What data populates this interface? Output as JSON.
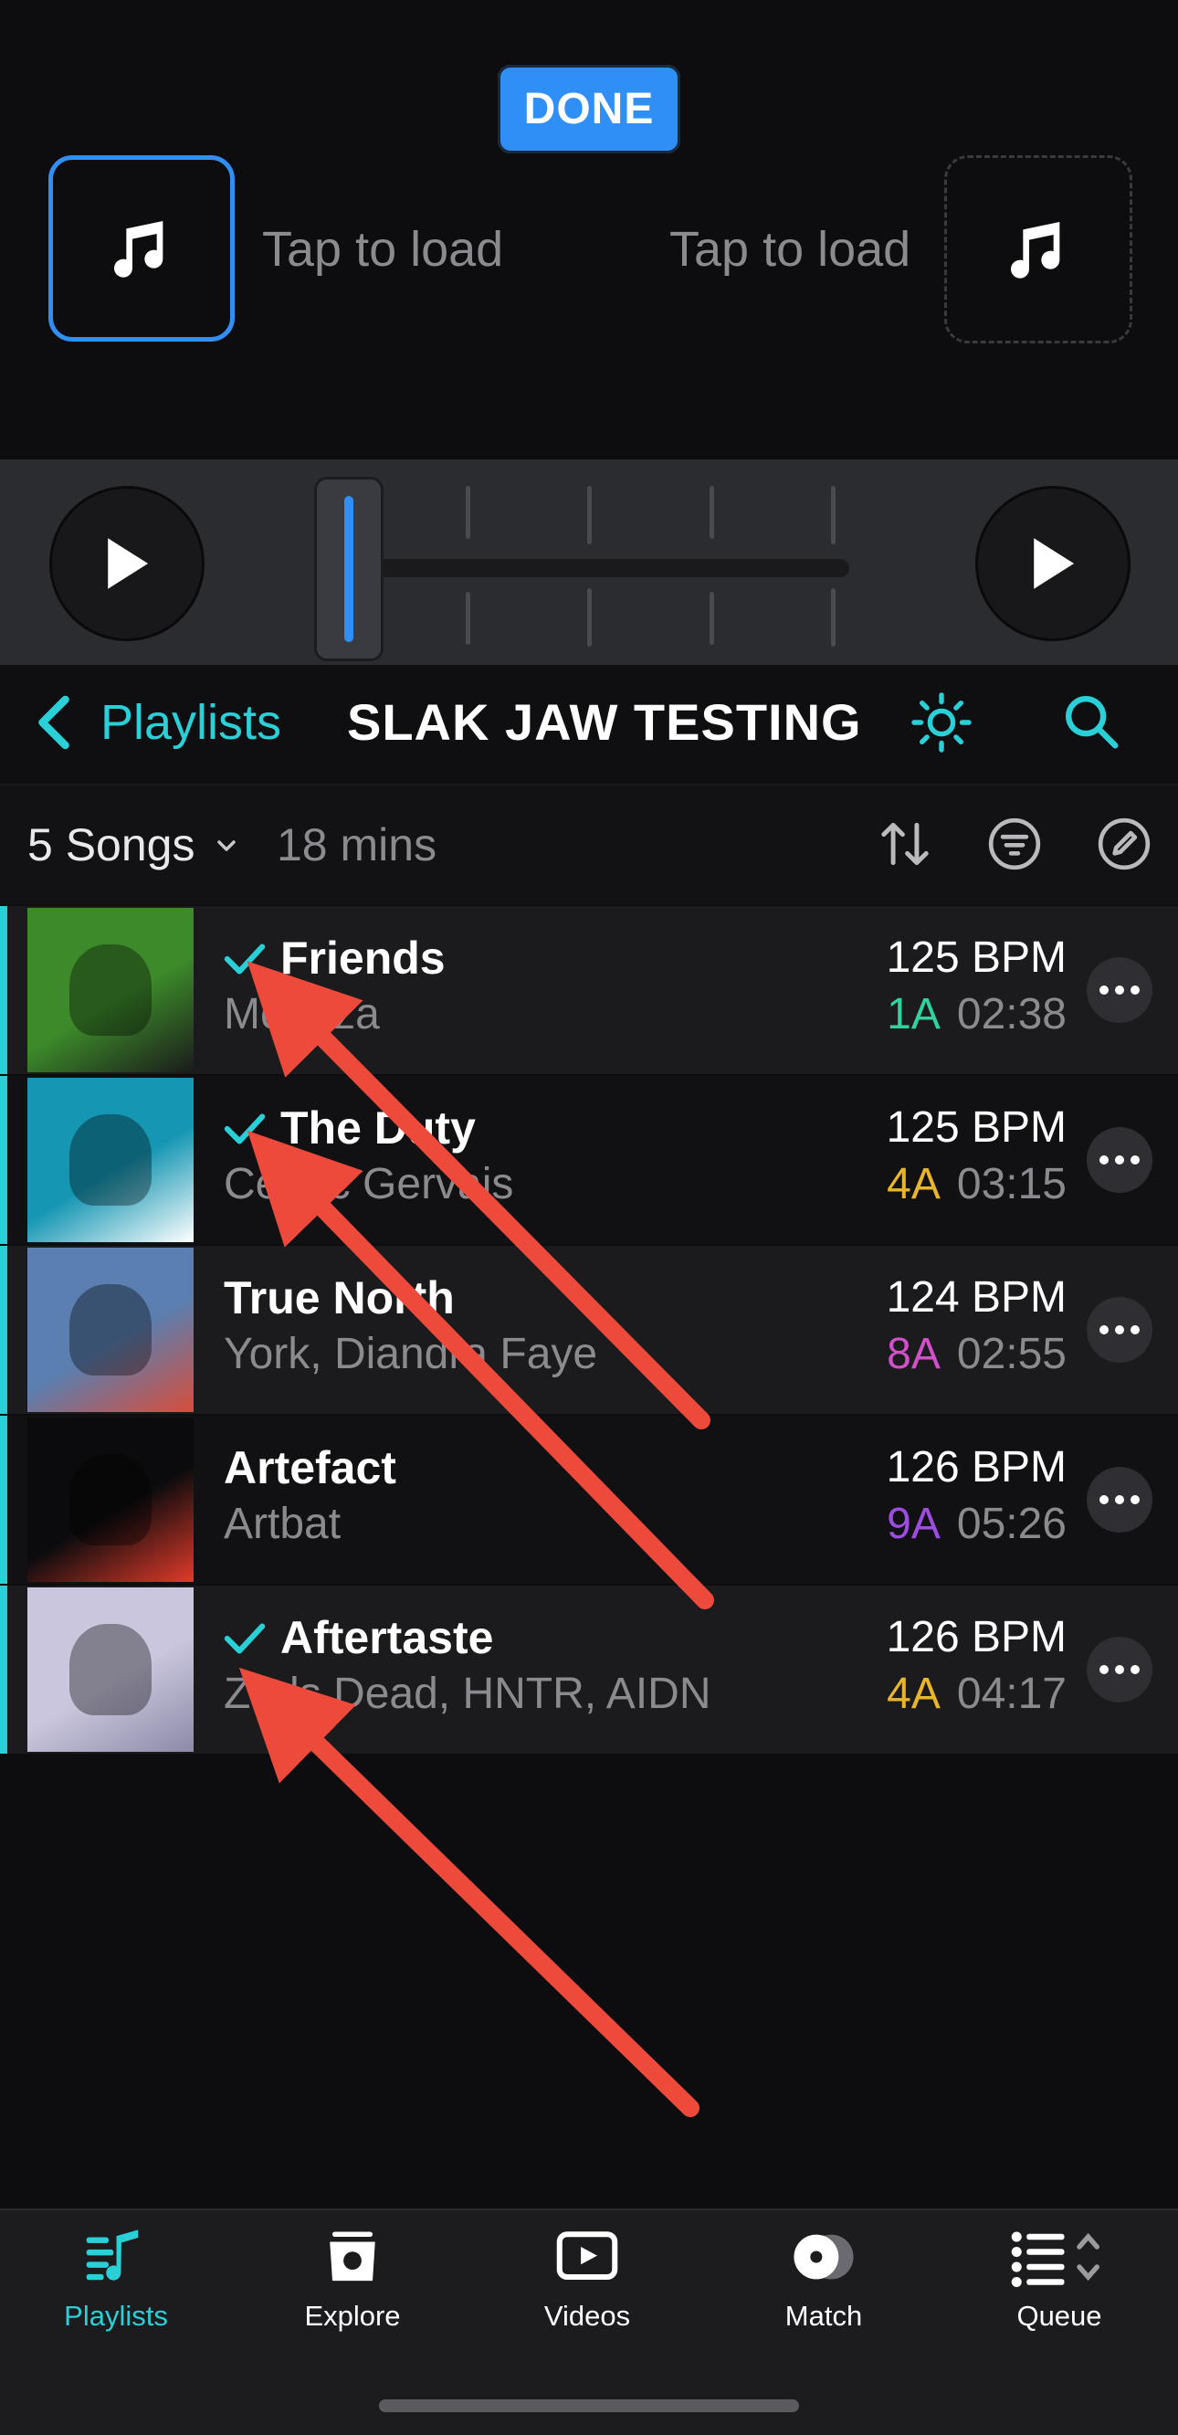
{
  "deck": {
    "done_label": "DONE",
    "left_slot_label": "Tap to load",
    "right_slot_label": "Tap to load"
  },
  "playlist_header": {
    "back_label": "Playlists",
    "title": "SLAK JAW TESTING"
  },
  "summary": {
    "songs_count": "5 Songs",
    "duration": "18 mins"
  },
  "songs": [
    {
      "title": "Friends",
      "artist": "Meduza",
      "bpm": "125 BPM",
      "key": "1A",
      "key_color": "#2fd39b",
      "duration": "02:38",
      "checked": true,
      "art_colors": [
        "#3c8a2a",
        "#1b1b1b"
      ]
    },
    {
      "title": "The Duty",
      "artist": "Cedric Gervais",
      "bpm": "125 BPM",
      "key": "4A",
      "key_color": "#e8b62c",
      "duration": "03:15",
      "checked": true,
      "art_colors": [
        "#1596b3",
        "#ffffff"
      ]
    },
    {
      "title": "True North",
      "artist": "York, Diandra Faye",
      "bpm": "124 BPM",
      "key": "8A",
      "key_color": "#d14fc7",
      "duration": "02:55",
      "checked": false,
      "art_colors": [
        "#5a7fb0",
        "#d84d3b"
      ]
    },
    {
      "title": "Artefact",
      "artist": "Artbat",
      "bpm": "126 BPM",
      "key": "9A",
      "key_color": "#9d4de0",
      "duration": "05:26",
      "checked": false,
      "art_colors": [
        "#0b0b0d",
        "#e23a2a"
      ]
    },
    {
      "title": "Aftertaste",
      "artist": "Zeds Dead, HNTR, AIDN",
      "bpm": "126 BPM",
      "key": "4A",
      "key_color": "#e8b62c",
      "duration": "04:17",
      "checked": true,
      "art_colors": [
        "#c9c6dd",
        "#8d8aa8"
      ]
    }
  ],
  "tabs": [
    {
      "label": "Playlists",
      "icon": "playlists-icon",
      "active": true
    },
    {
      "label": "Explore",
      "icon": "explore-icon",
      "active": false
    },
    {
      "label": "Videos",
      "icon": "videos-icon",
      "active": false
    },
    {
      "label": "Match",
      "icon": "match-icon",
      "active": false
    },
    {
      "label": "Queue",
      "icon": "queue-icon",
      "active": false
    }
  ],
  "colors": {
    "accent_teal": "#2ad0d8",
    "accent_blue": "#2f8ff5",
    "annotation_arrow": "#ee4a3c"
  }
}
